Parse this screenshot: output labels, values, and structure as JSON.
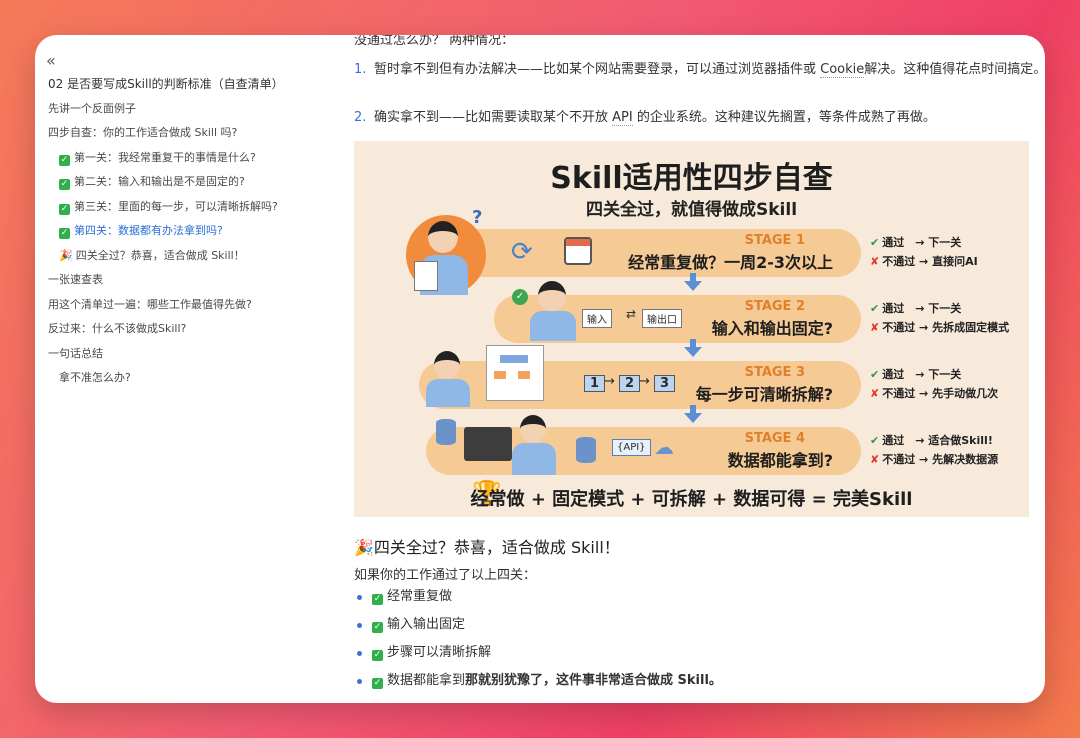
{
  "sidebar": {
    "collapse_icon": "«",
    "items": [
      {
        "label": "02 是否要写成Skill的判断标准（自查清单）",
        "level": 0
      },
      {
        "label": "先讲一个反面例子",
        "level": 0
      },
      {
        "label": "四步自查：你的工作适合做成 Skill 吗?",
        "level": 0
      },
      {
        "label": "第一关：我经常重复干的事情是什么?",
        "level": 1,
        "icon": "✅"
      },
      {
        "label": "第二关：输入和输出是不是固定的?",
        "level": 1,
        "icon": "✅"
      },
      {
        "label": "第三关：里面的每一步，可以清晰拆解吗?",
        "level": 1,
        "icon": "✅"
      },
      {
        "label": "第四关：数据都有办法拿到吗?",
        "level": 1,
        "icon": "✅",
        "active": true
      },
      {
        "label": "四关全过？恭喜，适合做成 Skill！",
        "level": 1,
        "icon": "🎉"
      },
      {
        "label": "一张速查表",
        "level": 0
      },
      {
        "label": "用这个清单过一遍：哪些工作最值得先做?",
        "level": 0
      },
      {
        "label": "反过来：什么不该做成Skill?",
        "level": 0
      },
      {
        "label": "一句话总结",
        "level": 0
      },
      {
        "label": "拿不准怎么办?",
        "level": 1
      }
    ]
  },
  "main": {
    "top_line": "没通过怎么办？ 两种情况：",
    "list": [
      {
        "num": "1.",
        "pre": "暂时拿不到但有办法解决——比如某个网站需要登录，可以通过浏览器插件或 ",
        "hl": "Cookie",
        "post": "解决。这种值得花点时间搞定。"
      },
      {
        "num": "2.",
        "pre": "确实拿不到——比如需要读取某个不开放 ",
        "hl": "API",
        "post": " 的企业系统。这种建议先搁置，等条件成熟了再做。"
      }
    ],
    "infographic": {
      "title": "Skill适用性四步自查",
      "subtitle": "四关全过，就值得做成Skill",
      "stages": [
        {
          "label": "STAGE 1",
          "question": "经常重复做？一周2-3次以上",
          "pass": "通过　→ 下一关",
          "fail": "不通过 → 直接问AI",
          "extras": [
            "",
            ""
          ]
        },
        {
          "label": "STAGE 2",
          "question": "输入和输出固定?",
          "pass": "通过　→ 下一关",
          "fail": "不通过 → 先拆成固定模式",
          "extras": [
            "输入",
            "输出口"
          ]
        },
        {
          "label": "STAGE 3",
          "question": "每一步可清晰拆解?",
          "pass": "通过　→ 下一关",
          "fail": "不通过 → 先手动做几次",
          "extras": [
            "1",
            "2",
            "3"
          ]
        },
        {
          "label": "STAGE 4",
          "question": "数据都能拿到?",
          "pass": "通过　→ 适合做Skill!",
          "fail": "不通过 → 先解决数据源",
          "extras": [
            "{API}"
          ]
        }
      ],
      "bottom": "经常做 + 固定模式 + 可拆解 + 数据可得 = 完美Skill"
    },
    "heading": "四关全过？恭喜，适合做成 Skill！",
    "heading_icon": "🎉",
    "intro": "如果你的工作通过了以上四关：",
    "bullets": [
      {
        "text": "经常重复做",
        "bold": ""
      },
      {
        "text": "输入输出固定",
        "bold": ""
      },
      {
        "text": "步骤可以清晰拆解",
        "bold": ""
      },
      {
        "text": "数据都能拿到",
        "bold": "那就别犹豫了，这件事非常适合做成 Skill。"
      }
    ]
  }
}
